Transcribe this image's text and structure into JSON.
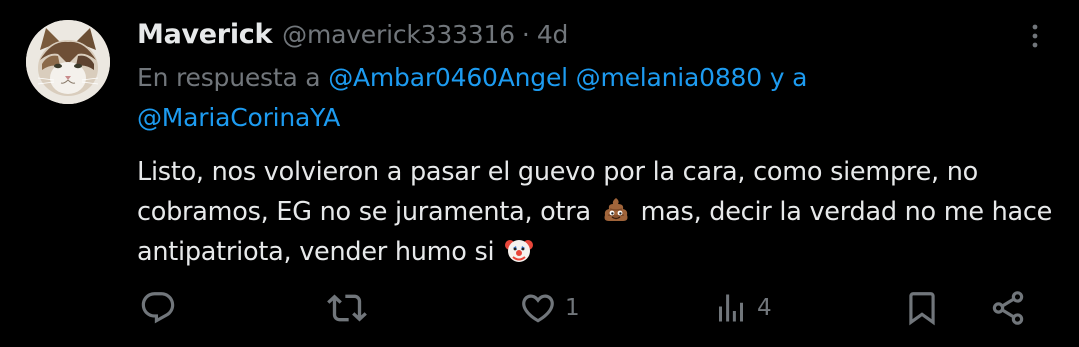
{
  "author": {
    "display_name": "Maverick",
    "handle": "@maverick333316",
    "separator": "·",
    "time": "4d",
    "avatar_icon": "cat-avatar"
  },
  "reply": {
    "prefix": "En respuesta a",
    "mention1": "@Ambar0460Angel",
    "mention2": "@melania0880",
    "conjunction": "y a",
    "mention3": "@MariaCorinaYA"
  },
  "text": {
    "part1": "Listo, nos volvieron a pasar el guevo por la cara, como siempre, no cobramos, EG no se juramenta, otra",
    "emoji1": "pile-of-poo-emoji",
    "part2": "mas, decir la verdad no me hace antipatriota, vender humo si",
    "emoji2": "clown-face-emoji"
  },
  "actions": {
    "reply_icon": "reply-icon",
    "retweet_icon": "retweet-icon",
    "like_icon": "heart-icon",
    "like_count": "1",
    "views_icon": "views-icon",
    "views_count": "4",
    "bookmark_icon": "bookmark-icon",
    "share_icon": "share-icon"
  },
  "colors": {
    "background": "#000000",
    "primary_text": "#e7e9ea",
    "secondary_text": "#71767b",
    "link": "#1d9bf0"
  }
}
